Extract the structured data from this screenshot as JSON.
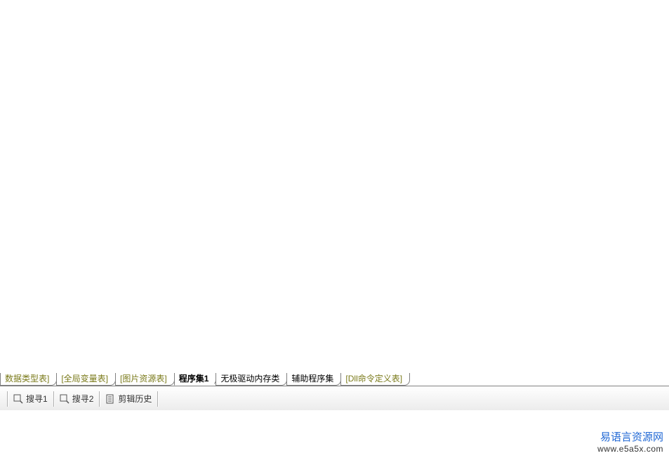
{
  "tabs": [
    {
      "label": "数据类型表]",
      "style": "olive"
    },
    {
      "label": "[全局变量表]",
      "style": "olive"
    },
    {
      "label": "[图片资源表]",
      "style": "olive"
    },
    {
      "label": "程序集1",
      "style": "active"
    },
    {
      "label": "无极驱动内存类",
      "style": "normal"
    },
    {
      "label": "辅助程序集",
      "style": "normal"
    },
    {
      "label": "[Dll命令定义表]",
      "style": "olive"
    }
  ],
  "bottomBar": {
    "search1": "搜寻1",
    "search2": "搜寻2",
    "clipHistory": "剪辑历史"
  },
  "watermark": {
    "title": "易语言资源网",
    "url": "www.e5a5x.com"
  }
}
